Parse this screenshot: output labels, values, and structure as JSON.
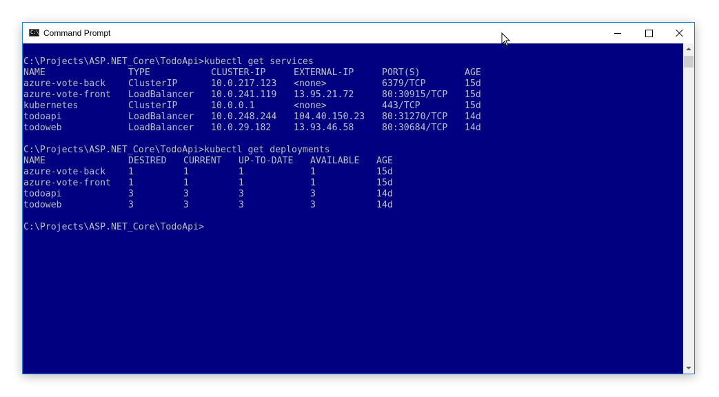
{
  "window": {
    "title": "Command Prompt",
    "icon_label": "C:\\",
    "colors": {
      "console_background": "#000080",
      "console_text": "#c0c0c0",
      "titlebar": "#ffffff",
      "window_border": "#1883d7"
    }
  },
  "console": {
    "prompt1": "C:\\Projects\\ASP.NET_Core\\TodoApi>kubectl get services",
    "services": {
      "headers": [
        "NAME",
        "TYPE",
        "CLUSTER-IP",
        "EXTERNAL-IP",
        "PORT(S)",
        "AGE"
      ],
      "rows": [
        [
          "azure-vote-back",
          "ClusterIP",
          "10.0.217.123",
          "<none>",
          "6379/TCP",
          "15d"
        ],
        [
          "azure-vote-front",
          "LoadBalancer",
          "10.0.241.119",
          "13.95.21.72",
          "80:30915/TCP",
          "15d"
        ],
        [
          "kubernetes",
          "ClusterIP",
          "10.0.0.1",
          "<none>",
          "443/TCP",
          "15d"
        ],
        [
          "todoapi",
          "LoadBalancer",
          "10.0.248.244",
          "104.40.150.23",
          "80:31270/TCP",
          "14d"
        ],
        [
          "todoweb",
          "LoadBalancer",
          "10.0.29.182",
          "13.93.46.58",
          "80:30684/TCP",
          "14d"
        ]
      ]
    },
    "prompt2": "C:\\Projects\\ASP.NET_Core\\TodoApi>kubectl get deployments",
    "deployments": {
      "headers": [
        "NAME",
        "DESIRED",
        "CURRENT",
        "UP-TO-DATE",
        "AVAILABLE",
        "AGE"
      ],
      "rows": [
        [
          "azure-vote-back",
          "1",
          "1",
          "1",
          "1",
          "15d"
        ],
        [
          "azure-vote-front",
          "1",
          "1",
          "1",
          "1",
          "15d"
        ],
        [
          "todoapi",
          "3",
          "3",
          "3",
          "3",
          "14d"
        ],
        [
          "todoweb",
          "3",
          "3",
          "3",
          "3",
          "14d"
        ]
      ]
    },
    "prompt3": "C:\\Projects\\ASP.NET_Core\\TodoApi>"
  },
  "icons": {
    "minimize": "minimize-icon",
    "maximize": "maximize-icon",
    "close": "close-icon",
    "scroll_up": "scroll-up-arrow-icon",
    "scroll_down": "scroll-down-arrow-icon",
    "cursor": "mouse-pointer-icon"
  }
}
